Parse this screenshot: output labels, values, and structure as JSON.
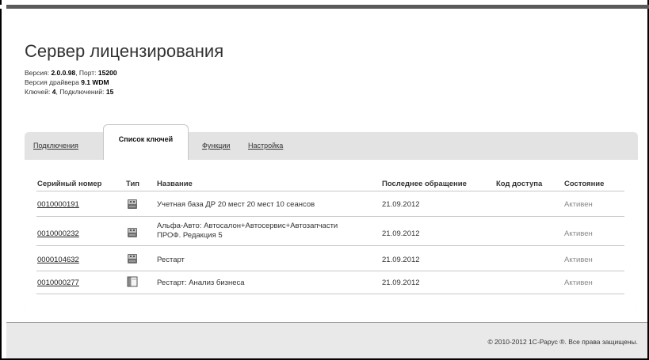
{
  "header": {
    "title": "Сервер лицензирования",
    "version_label": "Версия: ",
    "version_value": "2.0.0.98",
    "port_label": ", Порт: ",
    "port_value": "15200",
    "driver_label": "Версия драйвера ",
    "driver_value": "9.1 WDM",
    "keys_label": "Ключей: ",
    "keys_value": "4",
    "connections_label": ", Подключений: ",
    "connections_value": "15"
  },
  "tabs": [
    {
      "label": "Подключения",
      "active": false
    },
    {
      "label": "Список ключей",
      "active": true
    },
    {
      "label": "Функции",
      "active": false
    },
    {
      "label": "Настройка",
      "active": false
    }
  ],
  "table": {
    "columns": [
      "Серийный номер",
      "Тип",
      "Название",
      "Последнее обращение",
      "Код доступа",
      "Состояние"
    ],
    "rows": [
      {
        "serial": "0010000191",
        "type_icon": "usb-key-icon",
        "name_line1": "Учетная база ДР 20 мест 20 мест 10 сеансов",
        "name_line2": "",
        "last_access": "21.09.2012",
        "access_code": "",
        "status": "Активен"
      },
      {
        "serial": "0010000232",
        "type_icon": "usb-key-icon",
        "name_line1": "Альфа-Авто: Автосалон+Автосервис+Автозапчасти",
        "name_line2": "ПРОФ. Редакция 5",
        "last_access": "21.09.2012",
        "access_code": "",
        "status": "Активен"
      },
      {
        "serial": "0000104632",
        "type_icon": "usb-key-icon",
        "name_line1": "Рестарт",
        "name_line2": "",
        "last_access": "21.09.2012",
        "access_code": "",
        "status": "Активен"
      },
      {
        "serial": "0010000277",
        "type_icon": "software-key-icon",
        "name_line1": "Рестарт: Анализ бизнеса",
        "name_line2": "",
        "last_access": "21.09.2012",
        "access_code": "",
        "status": "Активен"
      }
    ]
  },
  "footer": {
    "copyright": "© 2010-2012 1С-Рарус ®. Все права защищены."
  }
}
